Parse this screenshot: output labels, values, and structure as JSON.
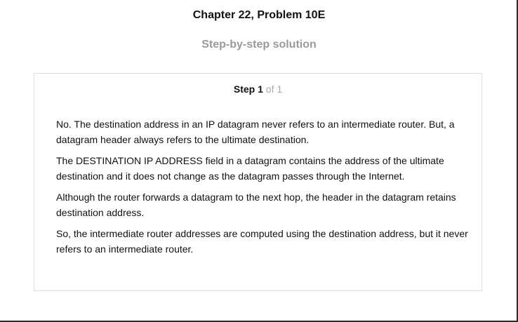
{
  "header": {
    "title": "Chapter 22, Problem 10E",
    "subtitle": "Step-by-step solution"
  },
  "step": {
    "label": "Step",
    "number": "1",
    "of_text": "of 1",
    "paragraphs": [
      "No. The destination address in an IP datagram never refers to an intermediate router. But, a datagram header always refers to the ultimate destination.",
      "The DESTINATION IP ADDRESS field in a datagram contains the address of the ultimate destination and it does not change as the datagram passes through the Internet.",
      "Although the router forwards a datagram to the next hop, the header in the datagram retains destination address.",
      "So, the intermediate router addresses are computed using the destination address, but it never refers to an intermediate router."
    ]
  }
}
